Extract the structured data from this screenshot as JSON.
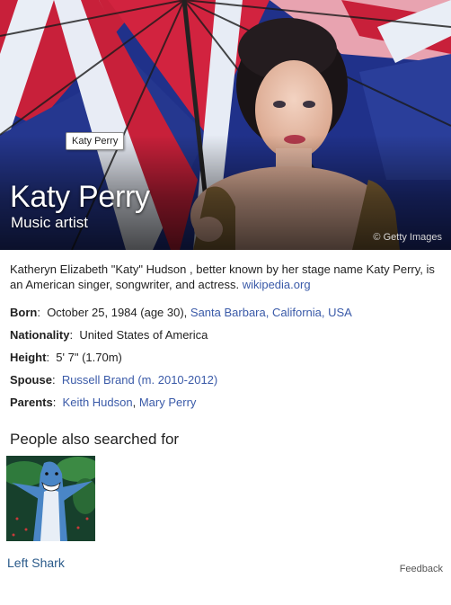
{
  "hero": {
    "tooltip": "Katy Perry",
    "title": "Katy Perry",
    "subtitle": "Music artist",
    "credit": "© Getty Images"
  },
  "description": {
    "text": "Katheryn Elizabeth \"Katy\" Hudson , better known by her stage name Katy Perry, is an American singer, songwriter, and actress. ",
    "source_link": "wikipedia.org"
  },
  "facts": {
    "born": {
      "label": "Born",
      "value": "October 25, 1984 (age 30), ",
      "link": "Santa Barbara, California, USA"
    },
    "nationality": {
      "label": "Nationality",
      "value": "United States of America"
    },
    "height": {
      "label": "Height",
      "value": "5' 7\" (1.70m)"
    },
    "spouse": {
      "label": "Spouse",
      "link": "Russell Brand (m. 2010-2012)"
    },
    "parents": {
      "label": "Parents",
      "link1": "Keith Hudson",
      "separator": ", ",
      "link2": "Mary Perry"
    }
  },
  "people_also": {
    "heading": "People also searched for",
    "items": [
      {
        "label": "Left Shark",
        "icon": "shark-costume-image"
      }
    ]
  },
  "feedback": "Feedback",
  "colors": {
    "link": "#3a5aa8",
    "thumb_link": "#2a5a8a",
    "hero_blue": "#1c2f7e",
    "hero_red": "#c8203a"
  }
}
